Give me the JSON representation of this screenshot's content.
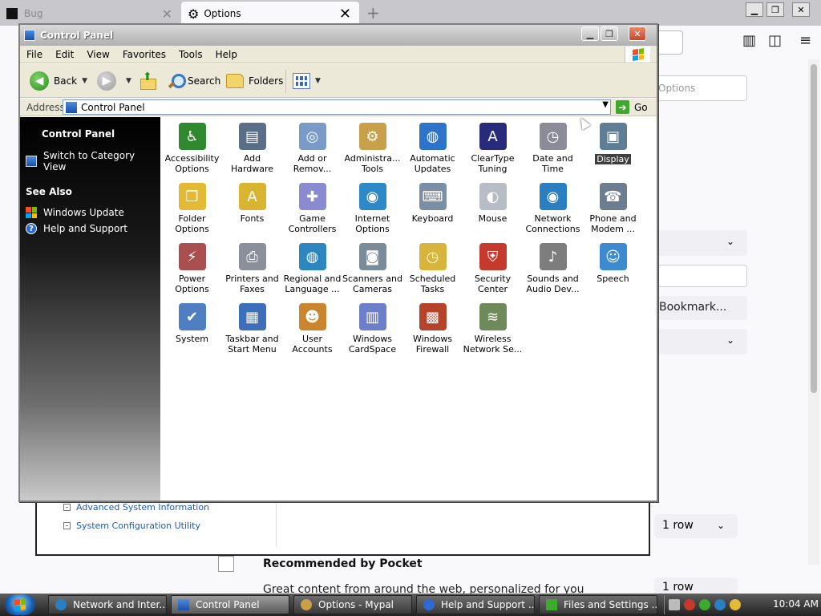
{
  "browser": {
    "tab1_label": "Bug",
    "tab2_label": "Options",
    "find_placeholder": "Options",
    "bookmark_label": "Bookmark...",
    "rows_select_1": "1 row",
    "rows_select_2": "1 row",
    "pocket_title": "Recommended by Pocket",
    "pocket_desc": "Great content from around the web, personalized for you"
  },
  "help_window": {
    "links": [
      "Advanced System Information",
      "System Configuration Utility"
    ]
  },
  "window": {
    "title": "Control Panel"
  },
  "menubar": [
    "File",
    "Edit",
    "View",
    "Favorites",
    "Tools",
    "Help"
  ],
  "toolbar": {
    "back": "Back",
    "search": "Search",
    "folders": "Folders"
  },
  "address": {
    "label": "Address",
    "value": "Control Panel",
    "go": "Go"
  },
  "sidebar": {
    "heading": "Control Panel",
    "switch_view": "Switch to Category View",
    "see_also": "See Also",
    "links": [
      "Windows Update",
      "Help and Support"
    ]
  },
  "items": [
    {
      "label": "Accessibility\nOptions",
      "icon": "accessibility-icon",
      "color": "#2f8a2f",
      "glyph": "♿"
    },
    {
      "label": "Add\nHardware",
      "icon": "add-hardware-icon",
      "color": "#5a6e88",
      "glyph": "▤"
    },
    {
      "label": "Add or\nRemov...",
      "icon": "add-remove-programs-icon",
      "color": "#7a9ac7",
      "glyph": "◎"
    },
    {
      "label": "Administra...\nTools",
      "icon": "admin-tools-icon",
      "color": "#c9a04a",
      "glyph": "⚙"
    },
    {
      "label": "Automatic\nUpdates",
      "icon": "automatic-updates-icon",
      "color": "#2d73c9",
      "glyph": "◍"
    },
    {
      "label": "ClearType\nTuning",
      "icon": "cleartype-icon",
      "color": "#2a2a7a",
      "glyph": "A"
    },
    {
      "label": "Date and\nTime",
      "icon": "date-time-icon",
      "color": "#8c8c99",
      "glyph": "◷"
    },
    {
      "label": "Display",
      "icon": "display-icon",
      "color": "#5f7e96",
      "glyph": "▣"
    },
    {
      "label": "Folder\nOptions",
      "icon": "folder-options-icon",
      "color": "#e4b935",
      "glyph": "❐"
    },
    {
      "label": "Fonts",
      "icon": "fonts-icon",
      "color": "#d8b430",
      "glyph": "A"
    },
    {
      "label": "Game\nControllers",
      "icon": "game-controllers-icon",
      "color": "#8a8ad0",
      "glyph": "✚"
    },
    {
      "label": "Internet\nOptions",
      "icon": "internet-options-icon",
      "color": "#2e8ac6",
      "glyph": "◉"
    },
    {
      "label": "Keyboard",
      "icon": "keyboard-icon",
      "color": "#7a8fa6",
      "glyph": "⌨"
    },
    {
      "label": "Mouse",
      "icon": "mouse-icon",
      "color": "#b8bcc4",
      "glyph": "◐"
    },
    {
      "label": "Network\nConnections",
      "icon": "network-connections-icon",
      "color": "#2b7fc0",
      "glyph": "◉"
    },
    {
      "label": "Phone and\nModem ...",
      "icon": "phone-modem-icon",
      "color": "#6c7d8f",
      "glyph": "☎"
    },
    {
      "label": "Power\nOptions",
      "icon": "power-options-icon",
      "color": "#a94f4f",
      "glyph": "⚡"
    },
    {
      "label": "Printers and\nFaxes",
      "icon": "printers-faxes-icon",
      "color": "#8a8f99",
      "glyph": "⎙"
    },
    {
      "label": "Regional and\nLanguage ...",
      "icon": "regional-language-icon",
      "color": "#2e86c1",
      "glyph": "◍"
    },
    {
      "label": "Scanners and\nCameras",
      "icon": "scanners-cameras-icon",
      "color": "#7a8b99",
      "glyph": "◙"
    },
    {
      "label": "Scheduled\nTasks",
      "icon": "scheduled-tasks-icon",
      "color": "#d9b43c",
      "glyph": "◷"
    },
    {
      "label": "Security\nCenter",
      "icon": "security-center-icon",
      "color": "#c63a2e",
      "glyph": "⛨"
    },
    {
      "label": "Sounds and\nAudio Dev...",
      "icon": "sounds-audio-icon",
      "color": "#7d7d7d",
      "glyph": "♪"
    },
    {
      "label": "Speech",
      "icon": "speech-icon",
      "color": "#3c8ad0",
      "glyph": "☺"
    },
    {
      "label": "System",
      "icon": "system-icon",
      "color": "#4f7fc2",
      "glyph": "✔"
    },
    {
      "label": "Taskbar and\nStart Menu",
      "icon": "taskbar-start-menu-icon",
      "color": "#3d6fb8",
      "glyph": "▦"
    },
    {
      "label": "User\nAccounts",
      "icon": "user-accounts-icon",
      "color": "#c9862f",
      "glyph": "☻"
    },
    {
      "label": "Windows\nCardSpace",
      "icon": "cardspace-icon",
      "color": "#6d7fc9",
      "glyph": "▥"
    },
    {
      "label": "Windows\nFirewall",
      "icon": "windows-firewall-icon",
      "color": "#b5432a",
      "glyph": "▩"
    },
    {
      "label": "Wireless\nNetwork Se...",
      "icon": "wireless-network-icon",
      "color": "#6f8a5a",
      "glyph": "≋"
    }
  ],
  "taskbar": {
    "buttons": [
      "Network and Inter...",
      "Control Panel",
      "Options - Mypal",
      "Help and Support ...",
      "Files and Settings ..."
    ],
    "clock": "10:04 AM"
  },
  "colors": {
    "sidebar_top": "#000000",
    "sidebar_bottom": "#c9c9c9",
    "menu_bg": "#ece9d8",
    "link_blue": "#1c5bbd"
  }
}
